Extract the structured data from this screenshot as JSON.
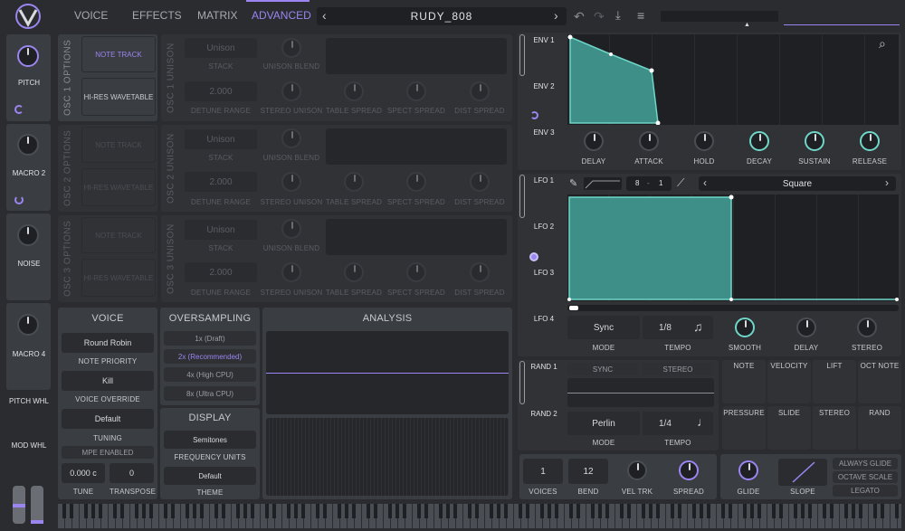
{
  "topbar": {
    "tabs": [
      "VOICE",
      "EFFECTS",
      "MATRIX",
      "ADVANCED"
    ],
    "active_tab": "ADVANCED",
    "preset_name": "RUDY_808",
    "prev": "‹",
    "next": "›"
  },
  "left": {
    "macros": [
      "PITCH",
      "MACRO 2",
      "NOISE",
      "MACRO 4"
    ],
    "wheels": [
      "PITCH WHL",
      "MOD WHL"
    ]
  },
  "osc": [
    {
      "options_title": "OSC 1 OPTIONS",
      "unison_title": "OSC 1 UNISON",
      "note_track": "NOTE TRACK",
      "hires": "HI-RES WAVETABLE",
      "stack_value": "Unison",
      "stack": "STACK",
      "blend": "UNISON BLEND",
      "detune_value": "2.000",
      "detune": "DETUNE RANGE",
      "stereo": "STEREO UNISON",
      "table": "TABLE SPREAD",
      "spect": "SPECT SPREAD",
      "dist": "DIST SPREAD"
    },
    {
      "options_title": "OSC 2 OPTIONS",
      "unison_title": "OSC 2 UNISON",
      "note_track": "NOTE TRACK",
      "hires": "HI-RES WAVETABLE",
      "stack_value": "Unison",
      "stack": "STACK",
      "blend": "UNISON BLEND",
      "detune_value": "2.000",
      "detune": "DETUNE RANGE",
      "stereo": "STEREO UNISON",
      "table": "TABLE SPREAD",
      "spect": "SPECT SPREAD",
      "dist": "DIST SPREAD"
    },
    {
      "options_title": "OSC 3 OPTIONS",
      "unison_title": "OSC 3 UNISON",
      "note_track": "NOTE TRACK",
      "hires": "HI-RES WAVETABLE",
      "stack_value": "Unison",
      "stack": "STACK",
      "blend": "UNISON BLEND",
      "detune_value": "2.000",
      "detune": "DETUNE RANGE",
      "stereo": "STEREO UNISON",
      "table": "TABLE SPREAD",
      "spect": "SPECT SPREAD",
      "dist": "DIST SPREAD"
    }
  ],
  "voice": {
    "title": "VOICE",
    "priority_value": "Round Robin",
    "priority": "NOTE PRIORITY",
    "override_value": "Kill",
    "override": "VOICE OVERRIDE",
    "tuning_value": "Default",
    "tuning": "TUNING",
    "mpe": "MPE ENABLED",
    "tune_value": "0.000 c",
    "tune": "TUNE",
    "transpose_value": "0",
    "transpose": "TRANSPOSE"
  },
  "oversampling": {
    "title": "OVERSAMPLING",
    "options": [
      "1x (Draft)",
      "2x (Recommended)",
      "4x (High CPU)",
      "8x (Ultra CPU)"
    ],
    "selected": "2x (Recommended)"
  },
  "display": {
    "title": "DISPLAY",
    "freq_value": "Semitones",
    "freq": "FREQUENCY UNITS",
    "theme_value": "Default",
    "theme": "THEME"
  },
  "analysis": {
    "title": "ANALYSIS"
  },
  "env": {
    "tabs": [
      "ENV 1",
      "ENV 2",
      "ENV 3"
    ],
    "knobs": [
      "DELAY",
      "ATTACK",
      "HOLD",
      "DECAY",
      "SUSTAIN",
      "RELEASE"
    ]
  },
  "lfo": {
    "tabs": [
      "LFO 1",
      "LFO 2",
      "LFO 3",
      "LFO 4"
    ],
    "grid_x": "8",
    "grid_sep": "-",
    "grid_y": "1",
    "shape": "Square",
    "mode_value": "Sync",
    "mode": "MODE",
    "tempo_value": "1/8",
    "tempo": "TEMPO",
    "knobs": [
      "SMOOTH",
      "DELAY",
      "STEREO"
    ]
  },
  "rand": {
    "tabs": [
      "RAND 1",
      "RAND 2"
    ],
    "sync": "SYNC",
    "stereo": "STEREO",
    "mode_value": "Perlin",
    "mode": "MODE",
    "tempo_value": "1/4",
    "tempo": "TEMPO"
  },
  "sources": {
    "row1": [
      "NOTE",
      "VELOCITY",
      "LIFT",
      "OCT NOTE"
    ],
    "row2": [
      "PRESSURE",
      "SLIDE",
      "STEREO",
      "RAND"
    ]
  },
  "voices": {
    "voices_value": "1",
    "voices": "VOICES",
    "bend_value": "12",
    "bend": "BEND",
    "veltrk": "VEL TRK",
    "spread": "SPREAD"
  },
  "glide": {
    "glide": "GLIDE",
    "slope": "SLOPE",
    "always": "ALWAYS GLIDE",
    "octave": "OCTAVE SCALE",
    "legato": "LEGATO"
  },
  "colors": {
    "accent": "#9b85f0",
    "teal": "#6fd6c8"
  }
}
